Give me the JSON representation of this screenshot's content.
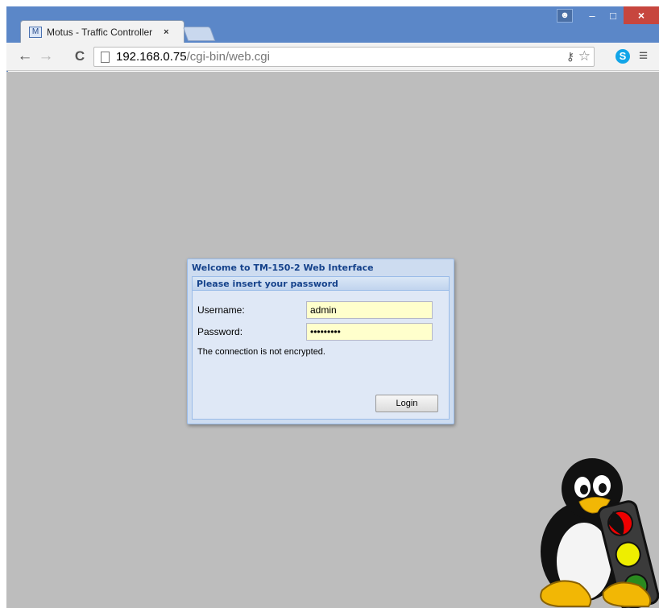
{
  "browser": {
    "tab_title": "Motus - Traffic Controller",
    "tab_close": "×",
    "url_host": "192.168.0.75",
    "url_path": "/cgi-bin/web.cgi",
    "nav": {
      "back": "←",
      "forward": "→",
      "reload": "C"
    },
    "window": {
      "minimize": "–",
      "maximize": "□",
      "close": "×"
    }
  },
  "login": {
    "dialog_title": "Welcome to TM-150-2 Web Interface",
    "fieldset_title": "Please insert your password",
    "username_label": "Username:",
    "username_value": "admin",
    "password_label": "Password:",
    "password_value": "•••••••••",
    "notice": "The connection is not encrypted.",
    "login_button": "Login"
  },
  "icons": {
    "tab_favicon": "traffic-controller-favicon",
    "omnibox": [
      "page-icon",
      "key-icon",
      "star-icon"
    ],
    "toolbar": [
      "skype-icon",
      "menu-icon"
    ],
    "mascot": "tux-traffic-light"
  },
  "colors": {
    "frame": "#5b87c8",
    "page_bg": "#bdbdbd",
    "dialog_bg": "#dfe8f6",
    "dialog_title": "#15428b",
    "input_bg": "#ffffcc",
    "close_button": "#c7463e"
  }
}
